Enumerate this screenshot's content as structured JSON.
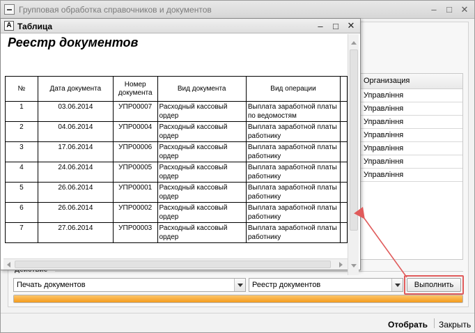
{
  "main_window": {
    "title": "Групповая обработка справочников и документов",
    "controls": [
      "–",
      "□",
      "✕"
    ]
  },
  "org_list": {
    "header": "Организация",
    "rows": [
      "Управління",
      "Управління",
      "Управління",
      "Управління",
      "Управління",
      "Управління",
      "Управління"
    ]
  },
  "actions": {
    "group_label": "Действие",
    "action_value": "Печать документов",
    "report_value": "Реестр документов",
    "run_label": "Выполнить",
    "progress_fraction": 1.0
  },
  "footer": {
    "select_label": "Отобрать",
    "close_label": "Закрыть"
  },
  "popup": {
    "title": "Таблица",
    "icon_letter": "A",
    "report_title": "Реестр документов",
    "columns": [
      "№",
      "Дата документа",
      "Номер документа",
      "Вид документа",
      "Вид операции"
    ],
    "rows": [
      {
        "num": "1",
        "date": "03.06.2014",
        "number": "УПР00007",
        "doc_type": "Расходный кассовый ордер",
        "operation": "Выплата заработной платы по ведомостям"
      },
      {
        "num": "2",
        "date": "04.06.2014",
        "number": "УПР00004",
        "doc_type": "Расходный кассовый ордер",
        "operation": "Выплата заработной платы работнику"
      },
      {
        "num": "3",
        "date": "17.06.2014",
        "number": "УПР00006",
        "doc_type": "Расходный кассовый ордер",
        "operation": "Выплата заработной платы работнику"
      },
      {
        "num": "4",
        "date": "24.06.2014",
        "number": "УПР00005",
        "doc_type": "Расходный кассовый ордер",
        "operation": "Выплата заработной платы работнику"
      },
      {
        "num": "5",
        "date": "26.06.2014",
        "number": "УПР00001",
        "doc_type": "Расходный кассовый ордер",
        "operation": "Выплата заработной платы работнику"
      },
      {
        "num": "6",
        "date": "26.06.2014",
        "number": "УПР00002",
        "doc_type": "Расходный кассовый ордер",
        "operation": "Выплата заработной платы работнику"
      },
      {
        "num": "7",
        "date": "27.06.2014",
        "number": "УПР00003",
        "doc_type": "Расходный кассовый ордер",
        "operation": "Выплата заработной платы работнику"
      }
    ]
  },
  "colors": {
    "highlight": "#e05b5b",
    "progress": "#f49b1c"
  }
}
